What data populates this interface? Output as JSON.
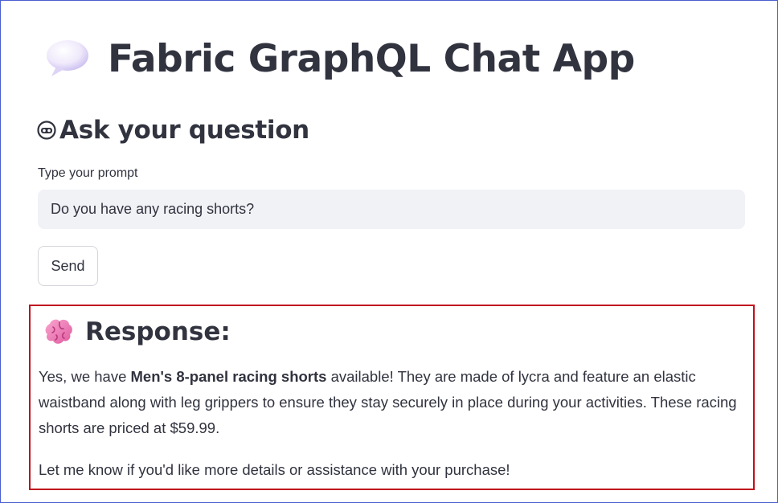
{
  "app": {
    "title": "Fabric GraphQL Chat App",
    "title_icon": "speech-bubble-icon"
  },
  "ask": {
    "heading": "Ask your question",
    "heading_icon": "alien-monster-icon",
    "prompt_label": "Type your prompt",
    "prompt_value": "Do you have any racing shorts?",
    "send_label": "Send"
  },
  "response": {
    "heading": "Response:",
    "heading_icon": "brain-icon",
    "p1_before": "Yes, we have ",
    "p1_bold": "Men's 8-panel racing shorts",
    "p1_after": " available! They are made of lycra and feature an elastic waistband along with leg grippers to ensure they stay securely in place during your activities. These racing shorts are priced at $59.99.",
    "p2": "Let me know if you'd like more details or assistance with your purchase!"
  },
  "colors": {
    "text": "#31333f",
    "input_bg": "#f0f2f6",
    "response_border": "#c0101c",
    "window_border": "#4a5fd0"
  }
}
